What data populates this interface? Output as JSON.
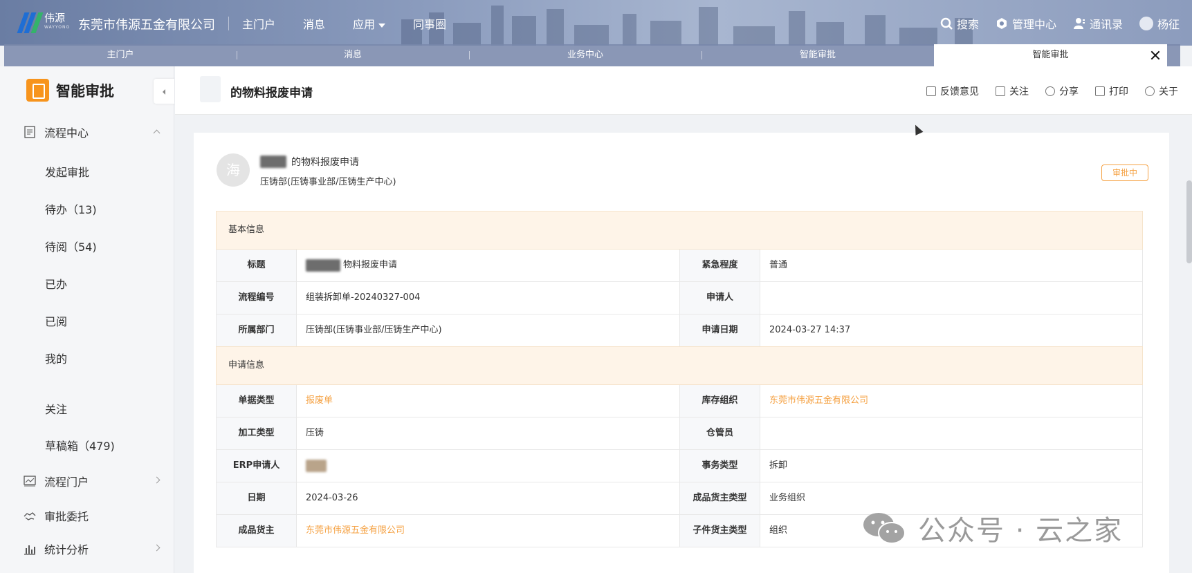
{
  "header": {
    "logo_text": "伟源",
    "logo_sub": "WAYYONG",
    "company": "东莞市伟源五金有限公司",
    "nav": [
      "主门户",
      "消息",
      "应用",
      "同事圈"
    ],
    "right": {
      "search": "搜索",
      "admin": "管理中心",
      "contacts": "通讯录",
      "user": "杨征"
    }
  },
  "tabs": [
    "主门户",
    "消息",
    "业务中心",
    "智能审批",
    "智能审批"
  ],
  "sidebar": {
    "app_name": "智能审批",
    "groups": {
      "process_center": "流程中心",
      "process_portal": "流程门户",
      "delegate": "审批委托",
      "stats": "统计分析"
    },
    "items": [
      "发起审批",
      "待办（13)",
      "待阅（54)",
      "已办",
      "已阅",
      "我的",
      "关注",
      "草稿箱（479)"
    ]
  },
  "main": {
    "title": "的物料报废申请",
    "actions": [
      "反馈意见",
      "关注",
      "分享",
      "打印",
      "关于"
    ]
  },
  "doc": {
    "avatar_char": "海",
    "title": "的物料报废申请",
    "dept": "压铸部(压铸事业部/压铸生产中心)",
    "status": "审批中",
    "basic_section": "基本信息",
    "basic": [
      {
        "l1": "标题",
        "v1": "物料报废申请",
        "l2": "紧急程度",
        "v2": "普通"
      },
      {
        "l1": "流程编号",
        "v1": "组装拆卸单-20240327-004",
        "l2": "申请人",
        "v2": ""
      },
      {
        "l1": "所属部门",
        "v1": "压铸部(压铸事业部/压铸生产中心)",
        "l2": "申请日期",
        "v2": "2024-03-27 14:37"
      }
    ],
    "apply_section": "申请信息",
    "apply": [
      {
        "l1": "单据类型",
        "v1": "报废单",
        "l2": "库存组织",
        "v2": "东莞市伟源五金有限公司"
      },
      {
        "l1": "加工类型",
        "v1": "压铸",
        "l2": "仓管员",
        "v2": ""
      },
      {
        "l1": "ERP申请人",
        "v1": "",
        "l2": "事务类型",
        "v2": "拆卸"
      },
      {
        "l1": "日期",
        "v1": "2024-03-26",
        "l2": "成品货主类型",
        "v2": "业务组织"
      },
      {
        "l1": "成品货主",
        "v1": "东莞市伟源五金有限公司",
        "l2": "子件货主类型",
        "v2": "组织"
      }
    ]
  },
  "watermark": "公众号 · 云之家",
  "colors": {
    "accent": "#f5a142",
    "section_bg": "#fef4e8",
    "app_icon": "#f7941d"
  }
}
